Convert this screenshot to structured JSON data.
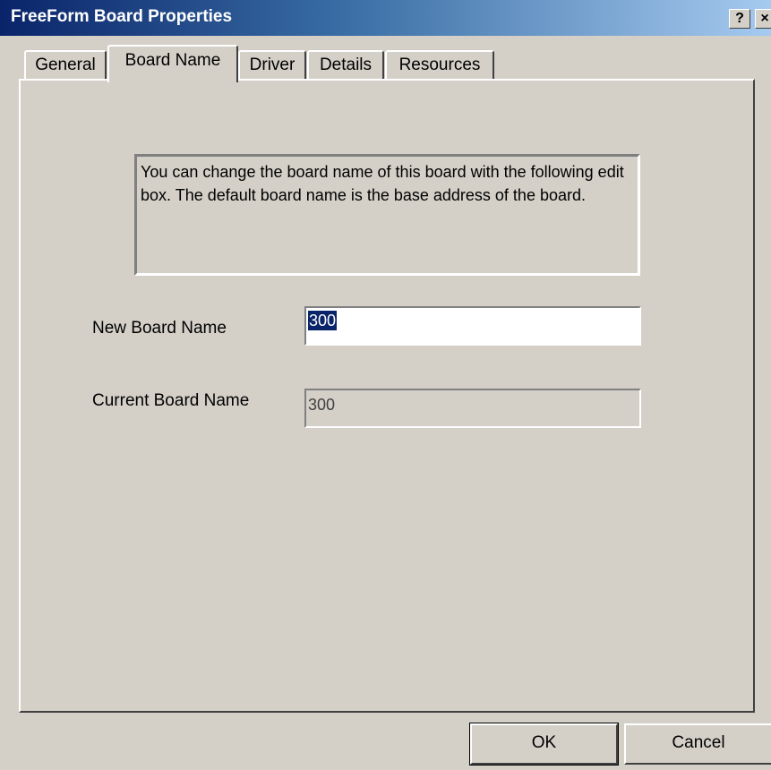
{
  "window": {
    "title": "FreeForm Board Properties",
    "help_glyph": "?",
    "close_glyph": "×"
  },
  "tabs": [
    {
      "label": "General",
      "active": false
    },
    {
      "label": "Board Name",
      "active": true
    },
    {
      "label": "Driver",
      "active": false
    },
    {
      "label": "Details",
      "active": false
    },
    {
      "label": "Resources",
      "active": false
    }
  ],
  "board_name_tab": {
    "info_text": "You can change the board name of this board with the following edit box. The default board name is the base address of the board.",
    "new_board_name_label": "New Board Name",
    "new_board_name_value": "300",
    "current_board_name_label": "Current Board Name",
    "current_board_name_value": "300"
  },
  "buttons": {
    "ok_label": "OK",
    "cancel_label": "Cancel"
  },
  "colors": {
    "title_bar_start": "#0a246a",
    "title_bar_end": "#a6caf0",
    "face": "#d4d0c8",
    "selection": "#0a246a"
  }
}
